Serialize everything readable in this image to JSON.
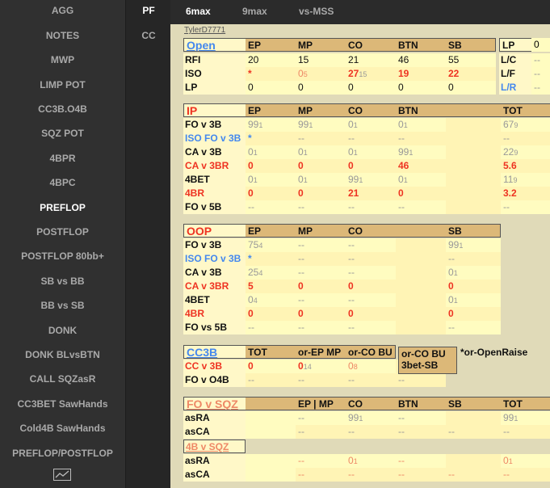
{
  "sidebar": {
    "items": [
      "AGG",
      "NOTES",
      "MWP",
      "LIMP POT",
      "CC3B.O4B",
      "SQZ POT",
      "4BPR",
      "4BPC",
      "PREFLOP",
      "POSTFLOP",
      "POSTFLOP 80bb+",
      "SB vs BB",
      "BB vs SB",
      "DONK",
      "DONK BLvsBTN",
      "CALL SQZasR",
      "CC3BET SawHands",
      "Cold4B SawHands",
      "PREFLOP/POSTFLOP"
    ],
    "active": "PREFLOP",
    "chart_icon": "chart-icon"
  },
  "sidebar2": {
    "items": [
      "PF",
      "CC"
    ],
    "active": "PF"
  },
  "tabs": {
    "items": [
      "6max",
      "9max",
      "vs-MSS"
    ],
    "active": "6max"
  },
  "player": "TylerD7771",
  "open": {
    "title": "Open",
    "headers": [
      "EP",
      "MP",
      "CO",
      "BTN",
      "SB"
    ],
    "rows": [
      {
        "label": "RFI",
        "label_color": "dark",
        "cells": [
          [
            "20",
            ""
          ],
          [
            "15",
            ""
          ],
          [
            "21",
            ""
          ],
          [
            "46",
            ""
          ],
          [
            "55",
            ""
          ]
        ],
        "style": "dark"
      },
      {
        "label": "ISO",
        "label_color": "dark",
        "cells": [
          [
            "*",
            ""
          ],
          [
            "0",
            "5"
          ],
          [
            "27",
            "15"
          ],
          [
            "19",
            ""
          ],
          [
            "22",
            ""
          ]
        ],
        "style": "mixed"
      },
      {
        "label": "LP",
        "label_color": "dark",
        "cells": [
          [
            "0",
            ""
          ],
          [
            "0",
            ""
          ],
          [
            "0",
            ""
          ],
          [
            "0",
            ""
          ],
          [
            "0",
            ""
          ]
        ],
        "style": "dark"
      }
    ],
    "side_header": "LP",
    "side_header_val": "0",
    "side_rows": [
      {
        "label": "L/C",
        "color": "dark",
        "val": "--"
      },
      {
        "label": "L/F",
        "color": "dark",
        "val": "--"
      },
      {
        "label": "L/R",
        "color": "blue",
        "val": "--"
      }
    ]
  },
  "ip": {
    "title": "IP",
    "headers": [
      "EP",
      "MP",
      "CO",
      "BTN",
      "",
      "TOT"
    ],
    "rows": [
      {
        "label": "FO v 3B",
        "color": "dark",
        "cells": [
          [
            "99",
            "1",
            "gray"
          ],
          [
            "99",
            "1",
            "gray"
          ],
          [
            "0",
            "1",
            "gray"
          ],
          [
            "0",
            "1",
            "gray"
          ],
          [
            "",
            ""
          ],
          [
            "67",
            "9",
            "gray"
          ]
        ]
      },
      {
        "label": "ISO FO v 3B",
        "color": "blue",
        "cells": [
          [
            "*",
            "",
            "blue"
          ],
          [
            "--",
            "",
            "gray"
          ],
          [
            "--",
            "",
            "gray"
          ],
          [
            "--",
            "",
            "gray"
          ],
          [
            "",
            ""
          ],
          [
            "--",
            "",
            "gray"
          ]
        ]
      },
      {
        "label": "CA v 3B",
        "color": "dark",
        "cells": [
          [
            "0",
            "1",
            "gray"
          ],
          [
            "0",
            "1",
            "gray"
          ],
          [
            "0",
            "1",
            "gray"
          ],
          [
            "99",
            "1",
            "gray"
          ],
          [
            "",
            ""
          ],
          [
            "22",
            "9",
            "gray"
          ]
        ]
      },
      {
        "label": "CA v 3BR",
        "color": "red",
        "cells": [
          [
            "0",
            "",
            "red"
          ],
          [
            "0",
            "",
            "red"
          ],
          [
            "0",
            "",
            "red"
          ],
          [
            "46",
            "",
            "red"
          ],
          [
            "",
            ""
          ],
          [
            "5.6",
            "",
            "red"
          ]
        ]
      },
      {
        "label": "4BET",
        "color": "dark",
        "cells": [
          [
            "0",
            "1",
            "gray"
          ],
          [
            "0",
            "1",
            "gray"
          ],
          [
            "99",
            "1",
            "gray"
          ],
          [
            "0",
            "1",
            "gray"
          ],
          [
            "",
            ""
          ],
          [
            "11",
            "9",
            "gray"
          ]
        ]
      },
      {
        "label": "4BR",
        "color": "red",
        "cells": [
          [
            "0",
            "",
            "red"
          ],
          [
            "0",
            "",
            "red"
          ],
          [
            "21",
            "",
            "red"
          ],
          [
            "0",
            "",
            "red"
          ],
          [
            "",
            ""
          ],
          [
            "3.2",
            "",
            "red"
          ]
        ]
      },
      {
        "label": "FO v 5B",
        "color": "dark",
        "cells": [
          [
            "--",
            "",
            "gray"
          ],
          [
            "--",
            "",
            "gray"
          ],
          [
            "--",
            "",
            "gray"
          ],
          [
            "--",
            "",
            "gray"
          ],
          [
            "",
            ""
          ],
          [
            "--",
            "",
            "gray"
          ]
        ]
      }
    ]
  },
  "oop": {
    "title": "OOP",
    "headers": [
      "EP",
      "MP",
      "CO",
      "",
      "SB"
    ],
    "rows": [
      {
        "label": "FO v 3B",
        "color": "dark",
        "cells": [
          [
            "75",
            "4",
            "gray"
          ],
          [
            "--",
            "",
            "gray"
          ],
          [
            "--",
            "",
            "gray"
          ],
          [
            "",
            ""
          ],
          [
            "99",
            "1",
            "gray"
          ]
        ]
      },
      {
        "label": "ISO FO v 3B",
        "color": "blue",
        "cells": [
          [
            "*",
            "",
            "blue"
          ],
          [
            "--",
            "",
            "gray"
          ],
          [
            "--",
            "",
            "gray"
          ],
          [
            "",
            ""
          ],
          [
            "--",
            "",
            "gray"
          ]
        ]
      },
      {
        "label": "CA v 3B",
        "color": "dark",
        "cells": [
          [
            "25",
            "4",
            "gray"
          ],
          [
            "--",
            "",
            "gray"
          ],
          [
            "--",
            "",
            "gray"
          ],
          [
            "",
            ""
          ],
          [
            "0",
            "1",
            "gray"
          ]
        ]
      },
      {
        "label": "CA v 3BR",
        "color": "red",
        "cells": [
          [
            "5",
            "",
            "red"
          ],
          [
            "0",
            "",
            "red"
          ],
          [
            "0",
            "",
            "red"
          ],
          [
            "",
            ""
          ],
          [
            "0",
            "",
            "red"
          ]
        ]
      },
      {
        "label": "4BET",
        "color": "dark",
        "cells": [
          [
            "0",
            "4",
            "gray"
          ],
          [
            "--",
            "",
            "gray"
          ],
          [
            "--",
            "",
            "gray"
          ],
          [
            "",
            ""
          ],
          [
            "0",
            "1",
            "gray"
          ]
        ]
      },
      {
        "label": "4BR",
        "color": "red",
        "cells": [
          [
            "0",
            "",
            "red"
          ],
          [
            "0",
            "",
            "red"
          ],
          [
            "0",
            "",
            "red"
          ],
          [
            "",
            ""
          ],
          [
            "0",
            "",
            "red"
          ]
        ]
      },
      {
        "label": "FO vs 5B",
        "color": "dark",
        "cells": [
          [
            "--",
            "",
            "gray"
          ],
          [
            "--",
            "",
            "gray"
          ],
          [
            "--",
            "",
            "gray"
          ],
          [
            "",
            ""
          ],
          [
            "--",
            "",
            "gray"
          ]
        ]
      }
    ]
  },
  "cc3b": {
    "title": "CC3B",
    "headers": [
      "TOT",
      "or-EP MP",
      "or-CO BU"
    ],
    "box_line1": "or-CO BU",
    "box_line2": "3bet-SB",
    "note": "*or-OpenRaise",
    "rows": [
      {
        "label": "CC v 3B",
        "color": "red",
        "cells": [
          [
            "0",
            "",
            "red"
          ],
          [
            "0",
            "14",
            "mixed"
          ],
          [
            "0",
            "8",
            "lred"
          ],
          [
            "",
            ""
          ]
        ]
      },
      {
        "label": "FO v O4B",
        "color": "dark",
        "cells": [
          [
            "--",
            "",
            "gray"
          ],
          [
            "--",
            "",
            "gray"
          ],
          [
            "--",
            "",
            "gray"
          ],
          [
            "--",
            "",
            "gray"
          ]
        ]
      }
    ]
  },
  "fovsqz": {
    "title": "FO v SQZ",
    "headers": [
      "",
      "EP | MP",
      "CO",
      "BTN",
      "SB",
      "TOT"
    ],
    "rows": [
      {
        "label": "asRA",
        "color": "dark",
        "cells": [
          [
            "",
            ""
          ],
          [
            "--",
            "",
            "gray"
          ],
          [
            "99",
            "1",
            "gray"
          ],
          [
            "--",
            "",
            "gray"
          ],
          [
            "",
            ""
          ],
          [
            "99",
            "1",
            "gray"
          ]
        ]
      },
      {
        "label": "asCA",
        "color": "dark",
        "cells": [
          [
            "",
            ""
          ],
          [
            "--",
            "",
            "gray"
          ],
          [
            "--",
            "",
            "gray"
          ],
          [
            "--",
            "",
            "gray"
          ],
          [
            "--",
            "",
            "gray"
          ],
          [
            "--",
            "",
            "gray"
          ]
        ]
      }
    ]
  },
  "b4vsqz": {
    "title": "4B v SQZ",
    "rows": [
      {
        "label": "asRA",
        "color": "dark",
        "cells": [
          [
            "",
            ""
          ],
          [
            "--",
            "",
            "lred"
          ],
          [
            "0",
            "1",
            "lred"
          ],
          [
            "--",
            "",
            "lred"
          ],
          [
            "",
            ""
          ],
          [
            "0",
            "1",
            "lred"
          ]
        ]
      },
      {
        "label": "asCA",
        "color": "dark",
        "cells": [
          [
            "",
            ""
          ],
          [
            "--",
            "",
            "lred"
          ],
          [
            "--",
            "",
            "lred"
          ],
          [
            "--",
            "",
            "lred"
          ],
          [
            "--",
            "",
            "lred"
          ],
          [
            "--",
            "",
            "lred"
          ]
        ]
      }
    ]
  }
}
